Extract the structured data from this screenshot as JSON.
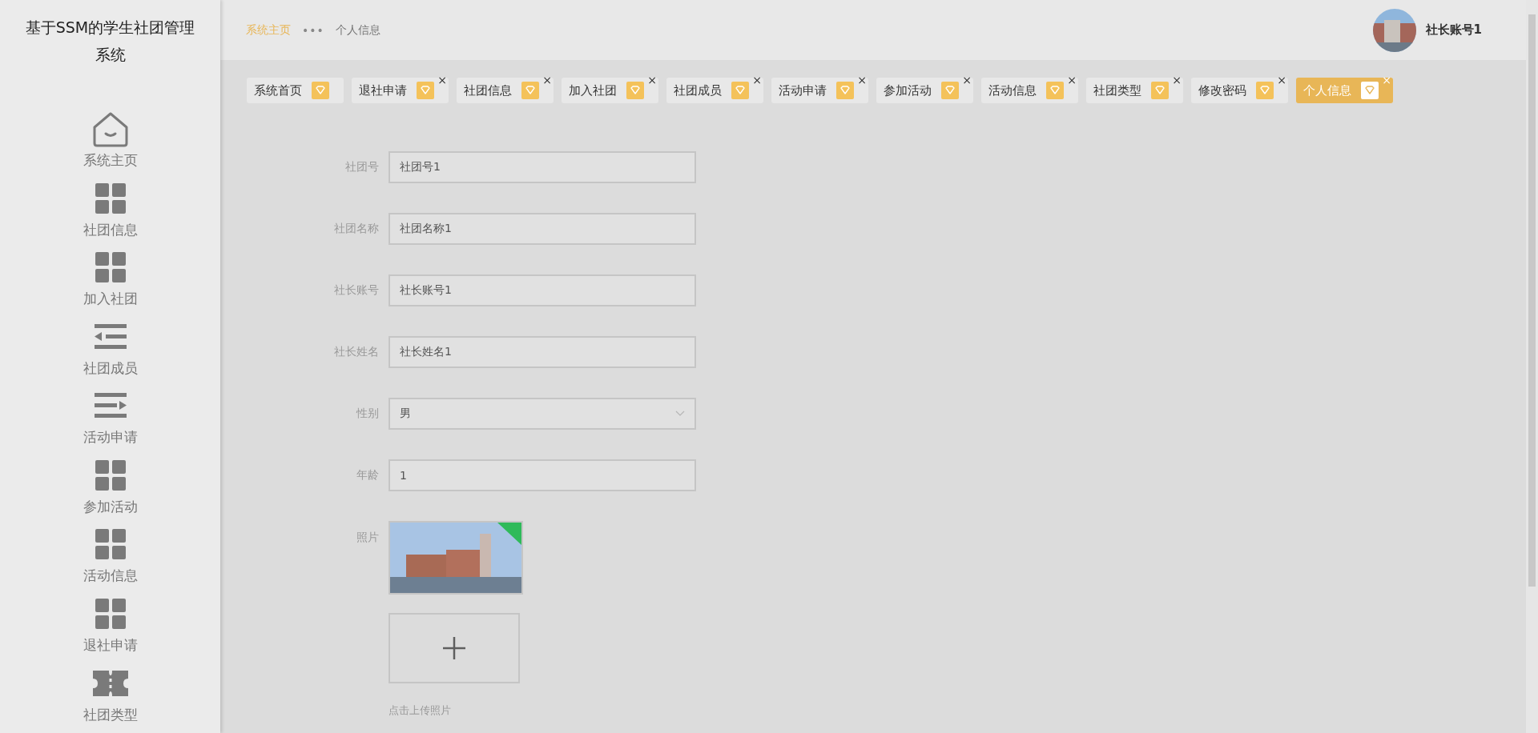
{
  "sidebar": {
    "title": "基于SSM的学生社团管理系统",
    "items": [
      {
        "label": "系统主页",
        "kind": "home",
        "selected": false
      },
      {
        "label": "社团信息",
        "kind": "grid",
        "selected": false
      },
      {
        "label": "加入社团",
        "kind": "grid",
        "selected": false
      },
      {
        "label": "社团成员",
        "kind": "indent",
        "selected": false
      },
      {
        "label": "活动申请",
        "kind": "outdent",
        "selected": false
      },
      {
        "label": "参加活动",
        "kind": "grid",
        "selected": false
      },
      {
        "label": "活动信息",
        "kind": "grid",
        "selected": false
      },
      {
        "label": "退社申请",
        "kind": "grid",
        "selected": false
      },
      {
        "label": "社团类型",
        "kind": "ticket",
        "selected": false
      }
    ]
  },
  "header": {
    "breadcrumb": [
      {
        "label": "系统主页",
        "kind": "link"
      },
      {
        "label": "•••",
        "kind": "separator"
      },
      {
        "label": "个人信息",
        "kind": "current"
      }
    ],
    "user": {
      "name": "社长账号1"
    }
  },
  "tabs": [
    {
      "label": "系统首页",
      "selected": false,
      "closable": false
    },
    {
      "label": "退社申请",
      "selected": false,
      "closable": true
    },
    {
      "label": "社团信息",
      "selected": false,
      "closable": true
    },
    {
      "label": "加入社团",
      "selected": false,
      "closable": true
    },
    {
      "label": "社团成员",
      "selected": false,
      "closable": true
    },
    {
      "label": "活动申请",
      "selected": false,
      "closable": true
    },
    {
      "label": "参加活动",
      "selected": false,
      "closable": true
    },
    {
      "label": "活动信息",
      "selected": false,
      "closable": true
    },
    {
      "label": "社团类型",
      "selected": false,
      "closable": true
    },
    {
      "label": "修改密码",
      "selected": false,
      "closable": true
    },
    {
      "label": "个人信息",
      "selected": true,
      "closable": true
    }
  ],
  "close_symbol": "×",
  "form": {
    "fields": [
      {
        "label": "社团号",
        "kind": "text",
        "value": "社团号1"
      },
      {
        "label": "社团名称",
        "kind": "text",
        "value": "社团名称1"
      },
      {
        "label": "社长账号",
        "kind": "text",
        "value": "社长账号1"
      },
      {
        "label": "社长姓名",
        "kind": "text",
        "value": "社长姓名1"
      },
      {
        "label": "性别",
        "kind": "select",
        "value": "男"
      },
      {
        "label": "年龄",
        "kind": "text",
        "value": "1"
      },
      {
        "label": "照片",
        "kind": "photo",
        "hint": "点击上传照片"
      }
    ]
  }
}
